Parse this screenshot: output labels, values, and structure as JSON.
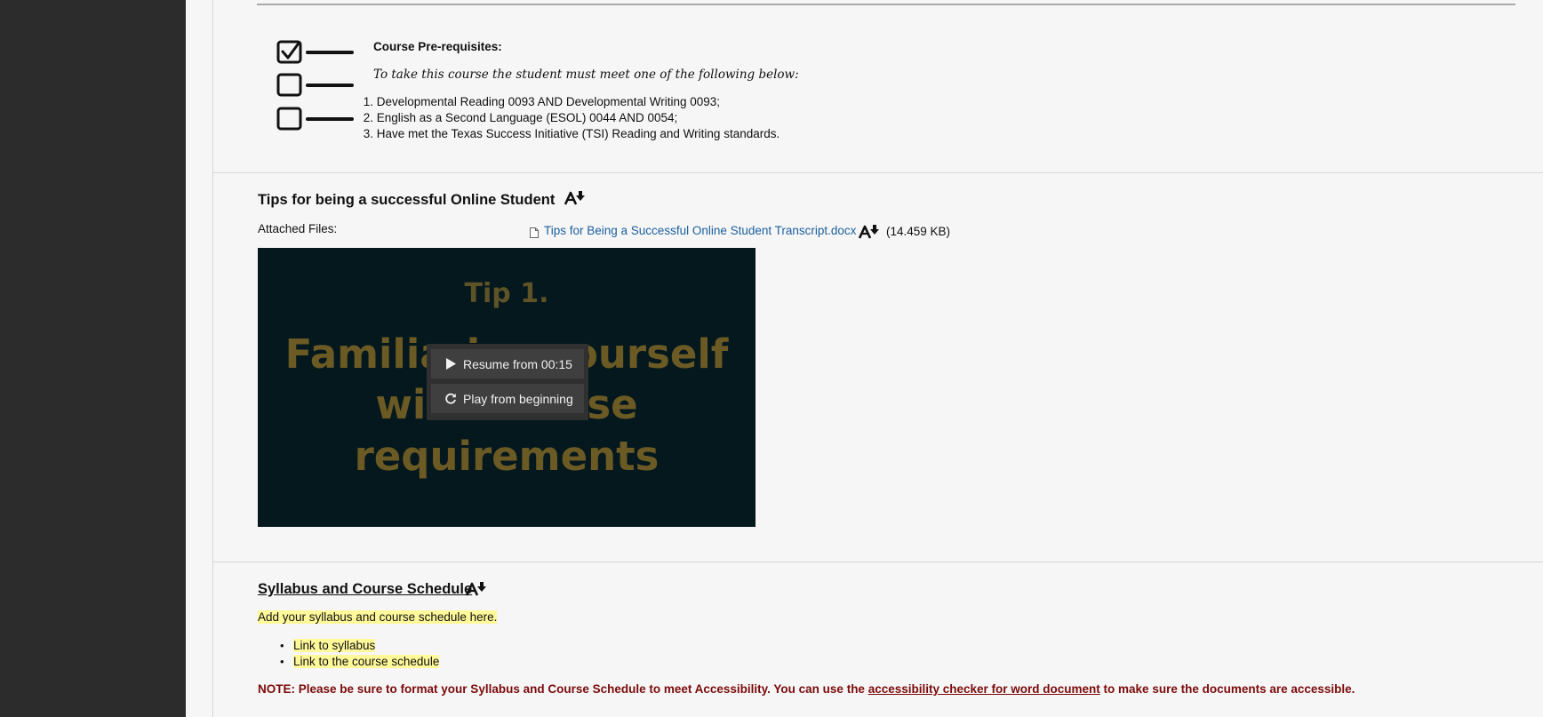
{
  "prerequisites": {
    "title": "Course Pre-requisites:",
    "intro": "To take this course the student must meet one of the following below:",
    "items": [
      {
        "num": "1.",
        "text": "Developmental Reading 0093 AND Developmental Writing 0093;"
      },
      {
        "num": "2.",
        "text": "English as a Second Language (ESOL) 0044 AND 0054;"
      },
      {
        "num": "3.",
        "text": "Have met the Texas Success Initiative (TSI) Reading and Writing standards."
      }
    ]
  },
  "tips": {
    "title": "Tips for being a successful Online Student",
    "attached_label": "Attached Files:",
    "file_name": "Tips for Being a Successful Online Student Transcript.docx",
    "file_size": "(14.459 KB)",
    "video": {
      "line0": "Tip 1.",
      "line1": "Familiarize yourself",
      "line2": "with course",
      "line3": "requirements",
      "resume_label": "Resume from 00:15",
      "restart_label": "Play from beginning"
    }
  },
  "syllabus": {
    "title": "Syllabus and Course Schedule",
    "note": "Add your syllabus and course schedule here.",
    "links": [
      "Link to syllabus",
      "Link to the course schedule"
    ],
    "warning_prefix": "NOTE: Please be sure to format your Syllabus and Course Schedule to meet Accessibility. You can use the ",
    "warning_link": "accessibility checker for word document",
    "warning_suffix": " to make sure the documents are accessible."
  },
  "colors": {
    "rail": "#2c2c2c",
    "link": "#1a5f9e",
    "highlight": "#fff99a",
    "warning": "#7b0a0a",
    "video_bg": "#04181e"
  }
}
